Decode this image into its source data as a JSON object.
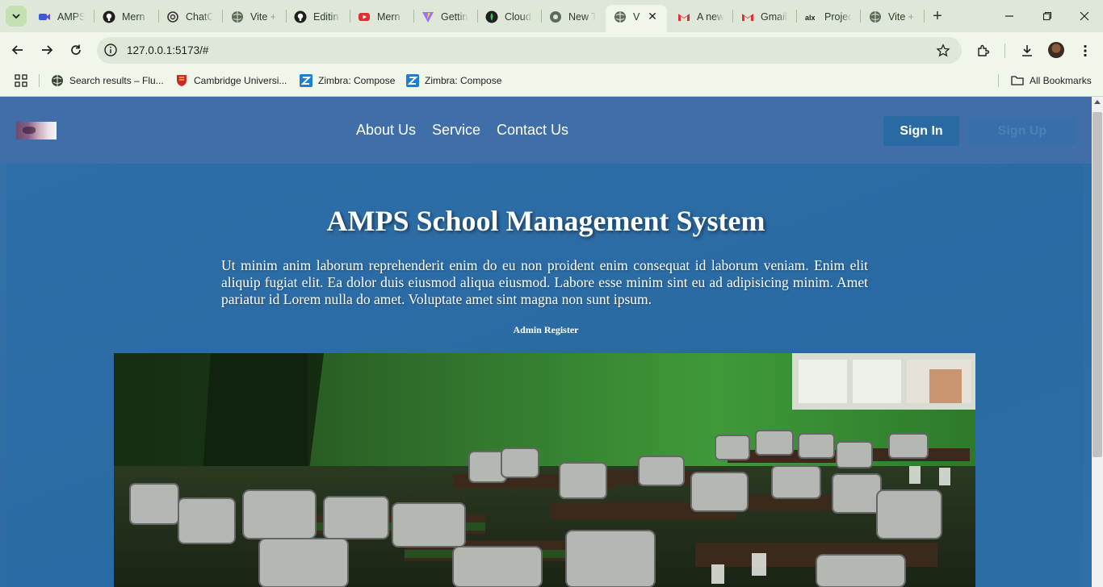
{
  "browser": {
    "tabs": [
      {
        "label": "AMPS",
        "icon": "video-icon"
      },
      {
        "label": "Mern",
        "icon": "github-icon"
      },
      {
        "label": "ChatG",
        "icon": "chatgpt-icon"
      },
      {
        "label": "Vite +",
        "icon": "globe-icon"
      },
      {
        "label": "Editin",
        "icon": "github-icon"
      },
      {
        "label": "Mern",
        "icon": "youtube-icon"
      },
      {
        "label": "Gettin",
        "icon": "vite-icon"
      },
      {
        "label": "Cloud",
        "icon": "mongodb-icon"
      },
      {
        "label": "New T",
        "icon": "chrome-icon"
      },
      {
        "label": "V",
        "icon": "globe-icon"
      },
      {
        "label": "A new",
        "icon": "gmail-icon"
      },
      {
        "label": "Gmail",
        "icon": "gmail-icon"
      },
      {
        "label": "Projec",
        "icon": "alx-icon"
      },
      {
        "label": "Vite +",
        "icon": "globe-icon"
      }
    ],
    "url": "127.0.0.1:5173/#",
    "bookmarks": [
      {
        "label": "Search results – Flu...",
        "icon": "globe-icon"
      },
      {
        "label": "Cambridge Universi...",
        "icon": "crest-icon"
      },
      {
        "label": "Zimbra: Compose",
        "icon": "zimbra-icon"
      },
      {
        "label": "Zimbra: Compose",
        "icon": "zimbra-icon"
      }
    ],
    "all_bookmarks_label": "All Bookmarks"
  },
  "site": {
    "nav": {
      "links": [
        "About Us",
        "Service",
        "Contact Us"
      ],
      "signin_label": "Sign In",
      "second_button_label": "Sign Up"
    },
    "hero": {
      "title": "AMPS School Management System",
      "description": "Ut minim anim laborum reprehenderit enim do eu non proident enim consequat id laborum veniam. Enim elit aliquip fugiat elit. Ea dolor duis eiusmod aliqua eiusmod. Labore esse minim sint eu ad adipisicing minim. Amet pariatur id Lorem nulla do amet. Voluptate amet sint magna non sunt ipsum.",
      "admin_register_label": "Admin Register"
    }
  },
  "colors": {
    "nav_bg": "#3f6ea8",
    "hero_bg": "#2a6aa3",
    "browser_frame": "#dfe8d8"
  }
}
